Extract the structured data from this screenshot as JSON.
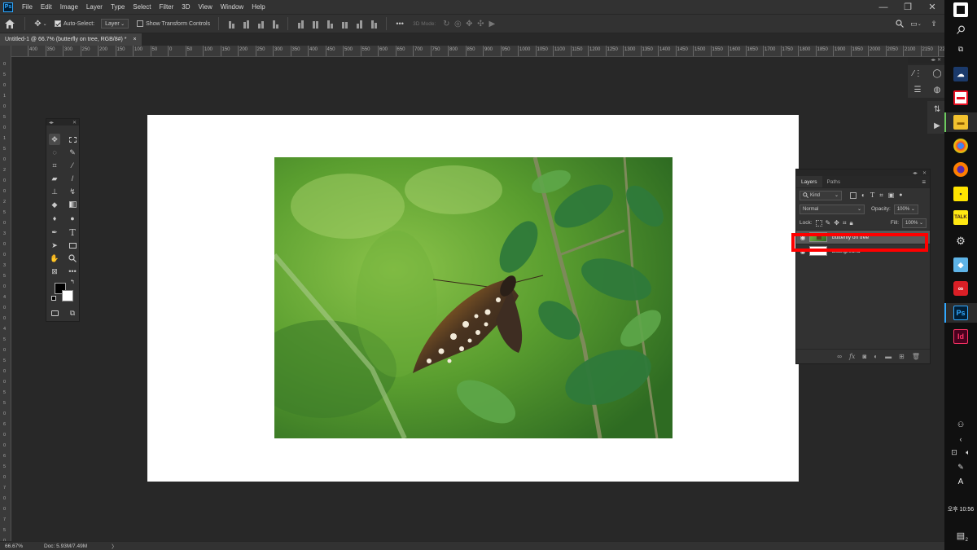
{
  "app": {
    "logo": "Ps"
  },
  "menu": [
    "File",
    "Edit",
    "Image",
    "Layer",
    "Type",
    "Select",
    "Filter",
    "3D",
    "View",
    "Window",
    "Help"
  ],
  "window_controls": {
    "minimize": "—",
    "maximize": "❐",
    "close": "✕"
  },
  "options_bar": {
    "auto_select_label": "Auto-Select:",
    "auto_select_target": "Layer",
    "show_transform_label": "Show Transform Controls",
    "mode_3d_label": "3D Mode:",
    "more": "•••"
  },
  "document_tab": {
    "title": "Untitled-1 @ 66.7% (butterfly on tree, RGB/8#) *",
    "close": "×"
  },
  "ruler": {
    "h_labels": [
      "400",
      "350",
      "300",
      "250",
      "200",
      "150",
      "100",
      "50",
      "0",
      "50",
      "100",
      "150",
      "200",
      "250",
      "300",
      "350",
      "400",
      "450",
      "500",
      "550",
      "600",
      "650",
      "700",
      "750",
      "800",
      "850",
      "900",
      "950",
      "1000",
      "1050",
      "1100",
      "1150",
      "1200",
      "1250",
      "1300",
      "1350",
      "1400",
      "1450",
      "1500",
      "1550",
      "1600",
      "1650",
      "1700",
      "1750",
      "1800",
      "1850",
      "1900",
      "1950",
      "2000",
      "2050",
      "2100",
      "2150",
      "2200",
      "225"
    ],
    "v_labels": [
      "0",
      "5",
      "0",
      "1",
      "0",
      "5",
      "0",
      "1",
      "5",
      "0",
      "2",
      "0",
      "0",
      "2",
      "5",
      "0",
      "3",
      "0",
      "0",
      "3",
      "5",
      "0",
      "4",
      "0",
      "0",
      "4",
      "5",
      "0",
      "5",
      "0",
      "0",
      "5",
      "5",
      "0",
      "6",
      "0",
      "0",
      "6",
      "5",
      "0",
      "7",
      "0",
      "0",
      "7",
      "5",
      "0"
    ]
  },
  "layers_panel": {
    "tabs": [
      "Layers",
      "Paths"
    ],
    "filter_kind": "Kind",
    "blend_mode": "Normal",
    "opacity_label": "Opacity:",
    "opacity_value": "100%",
    "lock_label": "Lock:",
    "fill_label": "Fill:",
    "fill_value": "100%",
    "layers": [
      {
        "name": "butterfly on tree",
        "visible": true,
        "selected": true
      },
      {
        "name": "Background",
        "visible": true,
        "selected": false,
        "locked": true
      }
    ],
    "footer_icons": [
      "link-icon",
      "fx-icon",
      "mask-icon",
      "adjustment-icon",
      "group-icon",
      "new-layer-icon",
      "trash-icon"
    ],
    "fx_label": "fx"
  },
  "status": {
    "zoom": "66.67%",
    "doc_info": "Doc: 5.93M/7.49M",
    "arrow": "〉"
  },
  "taskbar": {
    "time": "오후 10:56",
    "ime": "A",
    "notification_count": "2",
    "photoshop_icon": "Ps",
    "indesign_icon": "Id"
  },
  "colors": {
    "accent": "#31a8ff",
    "highlight": "#ff0000",
    "panel": "#323232",
    "workspace": "#282828"
  }
}
